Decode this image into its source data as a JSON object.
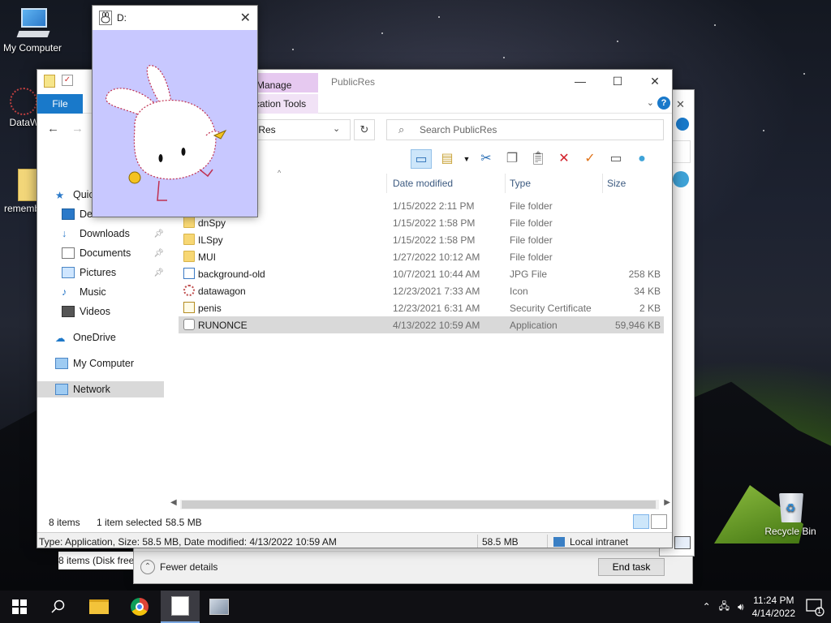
{
  "desktop": {
    "icons": [
      {
        "label": "My Computer",
        "icon": "my-computer-icon"
      },
      {
        "label": "DataWa",
        "icon": "datawagon-icon"
      },
      {
        "label": "rememb",
        "icon": "folder-icon"
      },
      {
        "label": "Recycle Bin",
        "icon": "recycle-bin-icon"
      }
    ]
  },
  "viewer": {
    "title": "D:",
    "close_glyph": "✕",
    "bg_color": "#c8c8ff"
  },
  "explorer": {
    "title": "PublicRes",
    "manage_tab": "Manage",
    "file_tab": "File",
    "app_tools_tab": "cation Tools",
    "address_text": "licRes",
    "search_placeholder": "Search PublicRes",
    "columns": {
      "name_sort": "^",
      "date": "Date modified",
      "type": "Type",
      "size": "Size"
    },
    "nav": [
      {
        "label": "Quic",
        "icon": "star-icon"
      },
      {
        "label": "De",
        "icon": "desktop-icon"
      },
      {
        "label": "Downloads",
        "icon": "download-icon",
        "pinned": true
      },
      {
        "label": "Documents",
        "icon": "documents-icon",
        "pinned": true
      },
      {
        "label": "Pictures",
        "icon": "pictures-icon",
        "pinned": true
      },
      {
        "label": "Music",
        "icon": "music-icon"
      },
      {
        "label": "Videos",
        "icon": "videos-icon"
      },
      {
        "label": "OneDrive",
        "icon": "cloud-icon"
      },
      {
        "label": "My Computer",
        "icon": "computer-icon"
      },
      {
        "label": "Network",
        "icon": "network-icon"
      }
    ],
    "files": [
      {
        "name": "",
        "date": "1/15/2022 2:11 PM",
        "type": "File folder",
        "size": "",
        "icon": "folder"
      },
      {
        "name": "dnSpy",
        "date": "1/15/2022 1:58 PM",
        "type": "File folder",
        "size": "",
        "icon": "folder"
      },
      {
        "name": "ILSpy",
        "date": "1/15/2022 1:58 PM",
        "type": "File folder",
        "size": "",
        "icon": "folder"
      },
      {
        "name": "MUI",
        "date": "1/27/2022 10:12 AM",
        "type": "File folder",
        "size": "",
        "icon": "folder"
      },
      {
        "name": "background-old",
        "date": "10/7/2021 10:44 AM",
        "type": "JPG File",
        "size": "258 KB",
        "icon": "image"
      },
      {
        "name": "datawagon",
        "date": "12/23/2021 7:33 AM",
        "type": "Icon",
        "size": "34 KB",
        "icon": "icon-file"
      },
      {
        "name": "penis",
        "date": "12/23/2021 6:31 AM",
        "type": "Security Certificate",
        "size": "2 KB",
        "icon": "certificate"
      },
      {
        "name": "RUNONCE",
        "date": "4/13/2022 10:59 AM",
        "type": "Application",
        "size": "59,946 KB",
        "icon": "application",
        "selected": true
      }
    ],
    "status": {
      "items": "8 items",
      "selected": "1 item selected",
      "sel_size": "58.5 MB"
    },
    "infobar": {
      "details": "Type: Application, Size: 58.5 MB, Date modified: 4/13/2022 10:59 AM",
      "size": "58.5 MB",
      "zone": "Local intranet"
    }
  },
  "taskmgr": {
    "status": "8 items (Disk free",
    "fewer_details": "Fewer details",
    "end_task": "End task"
  },
  "taskbar": {
    "time": "11:24 PM",
    "date": "4/14/2022",
    "notifications": "1",
    "apps": [
      "start",
      "search",
      "file-explorer",
      "chrome",
      "runonce-app",
      "image-app"
    ]
  }
}
